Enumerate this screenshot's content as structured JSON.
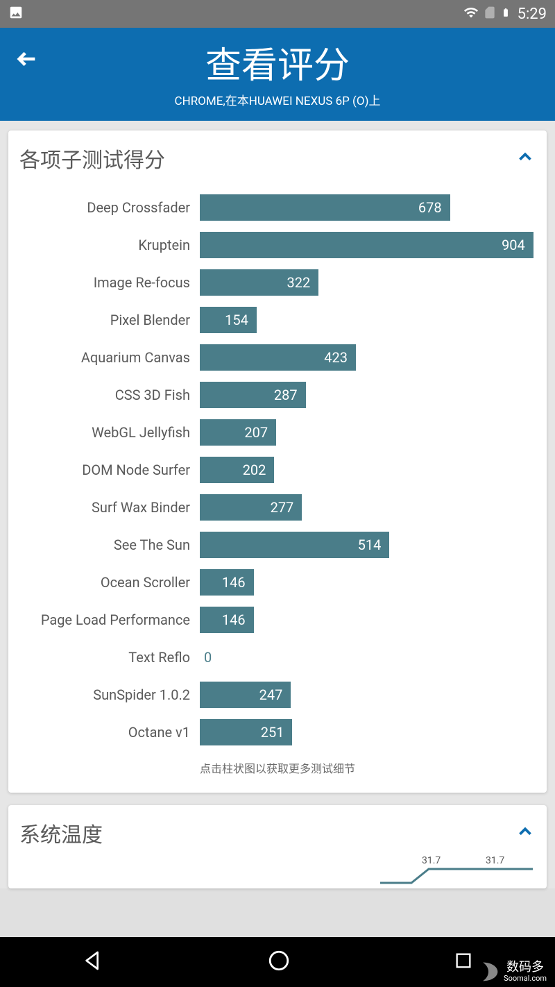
{
  "status": {
    "time": "5:29"
  },
  "header": {
    "title": "查看评分",
    "subtitle": "CHROME,在本HUAWEI NEXUS 6P (O)上"
  },
  "card1": {
    "title": "各项子测试得分",
    "footer": "点击柱状图以获取更多测试细节"
  },
  "card2": {
    "title": "系统温度",
    "line_values": [
      "31.7",
      "31.7"
    ]
  },
  "watermark": {
    "main": "数码多",
    "sub": "Soomal.com"
  },
  "chart_data": {
    "type": "bar",
    "orientation": "horizontal",
    "title": "各项子测试得分",
    "max_value": 910,
    "categories": [
      "Deep Crossfader",
      "Kruptein",
      "Image Re-focus",
      "Pixel Blender",
      "Aquarium Canvas",
      "CSS 3D Fish",
      "WebGL Jellyfish",
      "DOM Node Surfer",
      "Surf Wax Binder",
      "See The Sun",
      "Ocean Scroller",
      "Page Load Performance",
      "Text Reflo",
      "SunSpider 1.0.2",
      "Octane v1"
    ],
    "values": [
      678,
      904,
      322,
      154,
      423,
      287,
      207,
      202,
      277,
      514,
      146,
      146,
      0,
      247,
      251
    ]
  }
}
